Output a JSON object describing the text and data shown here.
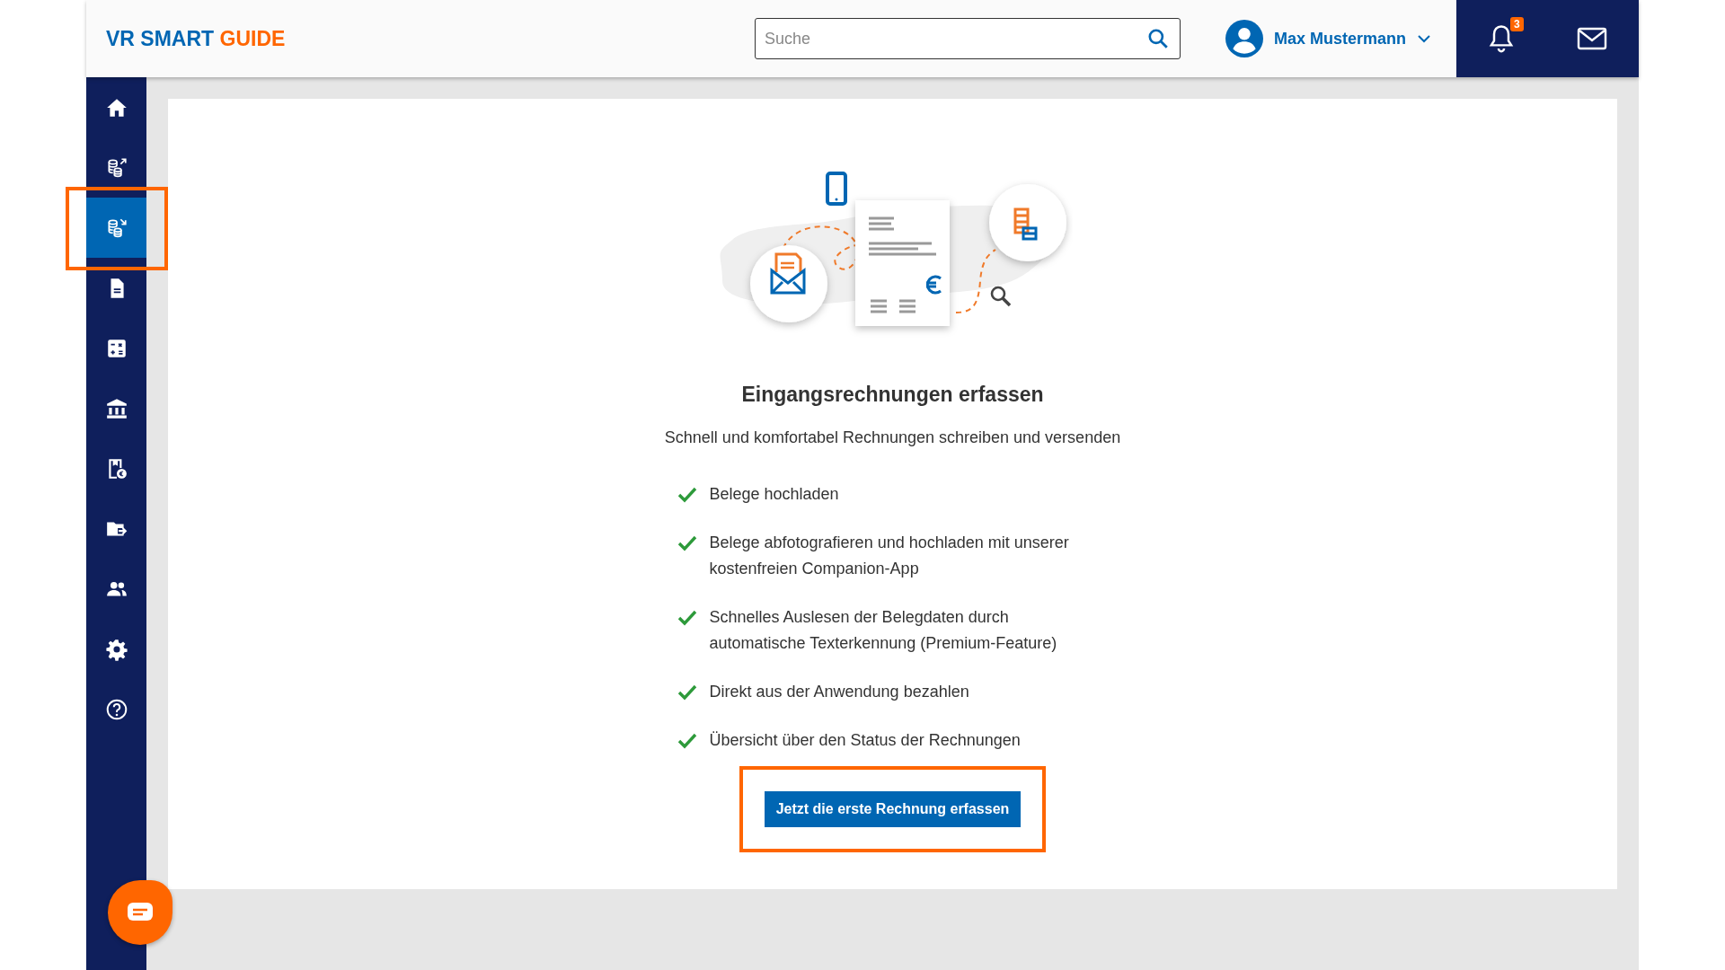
{
  "header": {
    "logo": {
      "part_1": "VR SMART",
      "part_2": "GUIDE"
    },
    "search": {
      "placeholder": "Suche"
    },
    "user": {
      "name": "Max Mustermann"
    },
    "notifications": {
      "badge": "3"
    }
  },
  "sidebar": {
    "items": [
      {
        "kind": "home",
        "selected": false,
        "highlighted": false
      },
      {
        "kind": "coins-out",
        "selected": false,
        "highlighted": false
      },
      {
        "kind": "coins-in",
        "selected": true,
        "highlighted": true
      },
      {
        "kind": "document",
        "selected": false,
        "highlighted": false
      },
      {
        "kind": "calculator",
        "selected": false,
        "highlighted": false
      },
      {
        "kind": "bank",
        "selected": false,
        "highlighted": false
      },
      {
        "kind": "receipt",
        "selected": false,
        "highlighted": false
      },
      {
        "kind": "folder",
        "selected": false,
        "highlighted": false
      },
      {
        "kind": "people",
        "selected": false,
        "highlighted": false
      },
      {
        "kind": "settings",
        "selected": false,
        "highlighted": false
      },
      {
        "kind": "help",
        "selected": false,
        "highlighted": false
      }
    ]
  },
  "content": {
    "title": "Eingangsrechnungen erfassen",
    "subtitle": "Schnell und komfortabel Rechnungen schreiben und versenden",
    "features": [
      "Belege hochladen",
      "Belege abfotografieren und hochladen mit unserer kostenfreien Companion-App",
      "Schnelles Auslesen der Belegdaten durch automatische Texterkennung (Premium-Feature)",
      "Direkt aus der Anwendung bezahlen",
      "Übersicht über den Status der Rechnungen"
    ],
    "button": {
      "label": "Jetzt die erste Rechnung erfassen",
      "highlighted": true
    }
  }
}
